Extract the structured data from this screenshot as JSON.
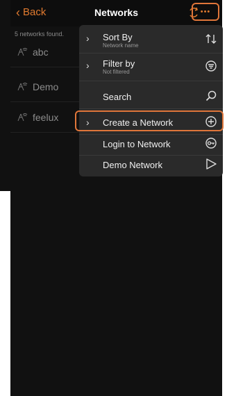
{
  "navbar": {
    "back_label": "Back",
    "title": "Networks",
    "more_label": "•••"
  },
  "networks": {
    "count_text": "5 networks found.",
    "items": [
      {
        "name": "abc",
        "icon": "network-icon"
      },
      {
        "name": "Demo",
        "icon": "network-icon"
      },
      {
        "name": "feelux",
        "icon": "network-icon"
      }
    ]
  },
  "menu": {
    "items": [
      {
        "label": "Sort By",
        "sublabel": "Network name",
        "icon": "sort-icon",
        "has_arrow": true
      },
      {
        "label": "Filter by",
        "sublabel": "Not filtered",
        "icon": "filter-icon",
        "has_arrow": true
      },
      {
        "label": "Search",
        "icon": "search-icon",
        "has_arrow": false
      },
      {
        "label": "Create a Network",
        "icon": "plus-circle-icon",
        "has_arrow": true,
        "highlighted": true
      },
      {
        "label": "Login to Network",
        "icon": "key-icon",
        "has_arrow": false
      },
      {
        "label": "Demo Network",
        "icon": "play-icon",
        "has_arrow": false
      }
    ]
  },
  "colors": {
    "accent": "#e07a2f",
    "highlight_border": "#e0763a",
    "background": "#111111",
    "menu_bg": "#2a2a2a"
  }
}
